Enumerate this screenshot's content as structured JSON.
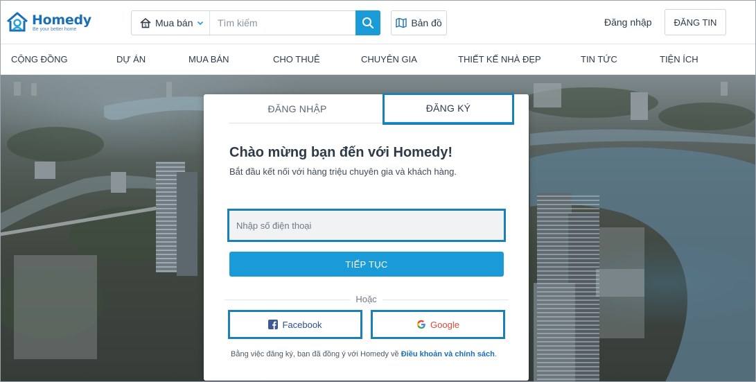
{
  "header": {
    "logo_text": "Homedy",
    "logo_tagline": "Be your better home",
    "search": {
      "type_label": "Mua bán",
      "placeholder": "Tìm kiếm"
    },
    "map_label": "Bản đồ",
    "login_label": "Đăng nhập",
    "post_label": "ĐĂNG TIN"
  },
  "nav": {
    "items": [
      {
        "label": "CỘNG ĐỒNG"
      },
      {
        "label": "DỰ ÁN"
      },
      {
        "label": "MUA BÁN"
      },
      {
        "label": "CHO THUÊ"
      },
      {
        "label": "CHUYÊN GIA"
      },
      {
        "label": "THIẾT KẾ NHÀ ĐẸP"
      },
      {
        "label": "TIN TỨC"
      },
      {
        "label": "TIỆN ÍCH"
      }
    ]
  },
  "modal": {
    "tabs": [
      {
        "label": "ĐĂNG NHẬP",
        "active": false
      },
      {
        "label": "ĐĂNG KÝ",
        "active": true
      }
    ],
    "welcome": "Chào mừng bạn đến với Homedy!",
    "subtitle": "Bắt đầu kết nối với hàng triệu chuyên gia và khách hàng.",
    "phone_placeholder": "Nhập số điện thoại",
    "continue_label": "TIẾP TỤC",
    "or_label": "Hoặc",
    "facebook_label": "Facebook",
    "google_label": "Google",
    "terms_prefix": "Bằng việc đăng ký, bạn đã đồng ý với Homedy về",
    "terms_link": "Điều khoản và chính sách",
    "terms_suffix": "."
  },
  "colors": {
    "accent": "#1a9ad6",
    "brand": "#1b6fb5",
    "highlight": "#1b7fb8"
  }
}
